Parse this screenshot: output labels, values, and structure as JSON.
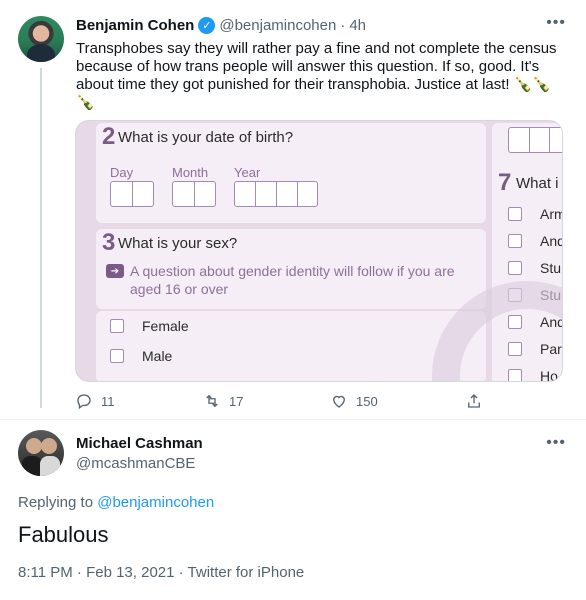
{
  "tweet": {
    "name": "Benjamin Cohen",
    "handle": "@benjamincohen",
    "separator": "·",
    "time": "4h",
    "more_icon": "ellipsis-icon",
    "text": "Transphobes say they will rather pay a fine and not complete the census because of how trans people will answer this question. If so, good. It's about time they got punished for their transphobia. Justice at last! 🍾🍾🍾",
    "media": {
      "q2_number": "2",
      "q2_text": "What is your date of birth?",
      "day_label": "Day",
      "month_label": "Month",
      "year_label": "Year",
      "q3_number": "3",
      "q3_text": "What is your sex?",
      "q3_note": "A question about gender identity will follow if you are aged 16 or over",
      "options": [
        "Female",
        "Male"
      ],
      "q7_number": "7",
      "q7_text": "What i",
      "q7_options": [
        "Arm",
        "And",
        "Stu",
        "Stu",
        "And",
        "Part",
        "Ho"
      ]
    },
    "actions": {
      "replies": "11",
      "retweets": "17",
      "likes": "150"
    }
  },
  "reply": {
    "name": "Michael Cashman",
    "handle": "@mcashmanCBE",
    "replying_prefix": "Replying to",
    "replying_to": "@benjamincohen",
    "text": "Fabulous",
    "meta": "8:11 PM · Feb 13, 2021 · Twitter for iPhone"
  },
  "colors": {
    "link": "#1d9bf0",
    "secondary_text": "#536471",
    "census_purple": "#7a5a86"
  }
}
